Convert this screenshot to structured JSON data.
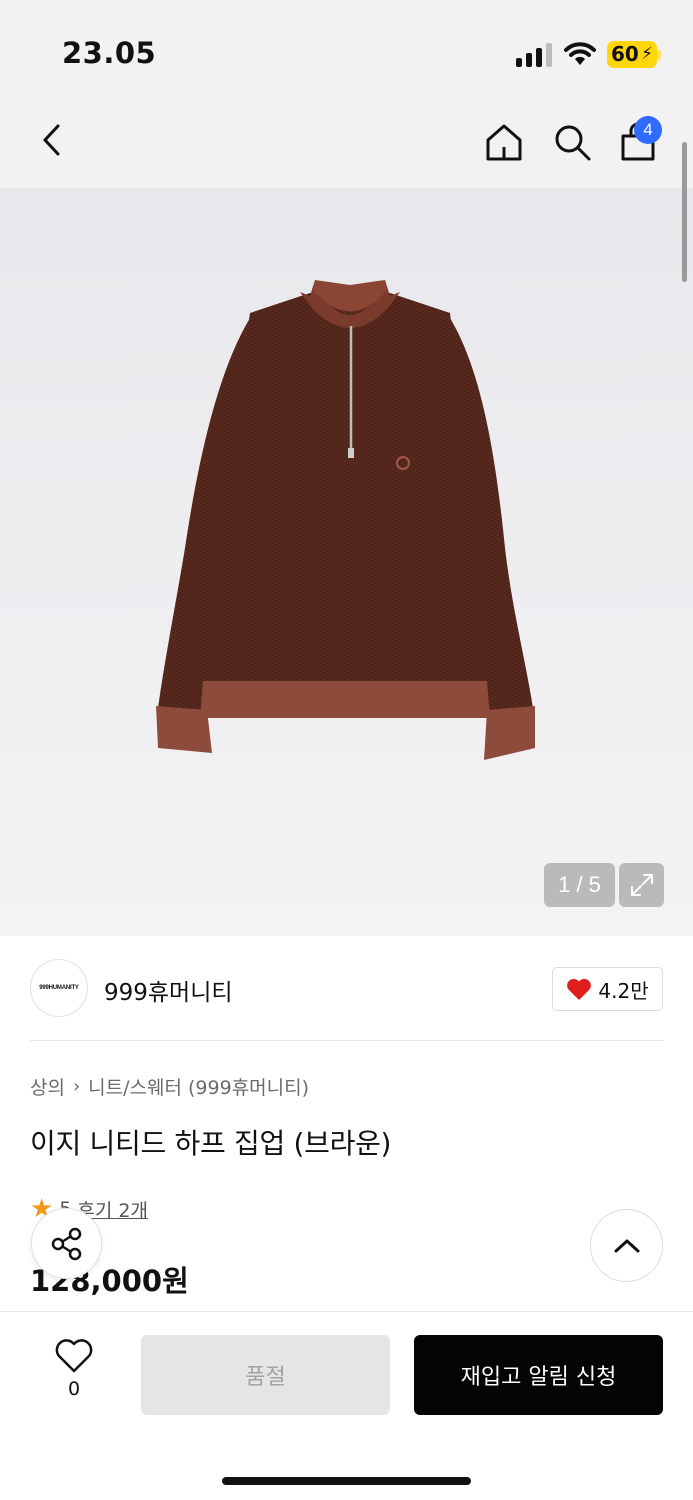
{
  "status_bar": {
    "time": "23.05",
    "battery_level": "60",
    "battery_color": "#ffd60a",
    "battery_charging_icon": "bolt-icon"
  },
  "header": {
    "back_icon": "chevron-left-icon",
    "home_icon": "home-icon",
    "search_icon": "search-icon",
    "cart_icon": "shopping-bag-icon",
    "cart_count": "4",
    "badge_color": "#2f6bff"
  },
  "gallery": {
    "counter": "1 / 5",
    "current_image": 1,
    "total_images": 5,
    "expand_icon": "expand-icon"
  },
  "brand": {
    "logo_text": "999HUMANITY",
    "name": "999휴머니티",
    "like_icon": "heart-filled-icon",
    "like_count": "4.2만",
    "like_color": "#e01e1e"
  },
  "product": {
    "breadcrumb": [
      "상의",
      "니트/스웨터 (999휴머니티)"
    ],
    "title": "이지 니티드 하프 집업 (브라운)",
    "rating": "5",
    "review_text": "후기 2개",
    "price": "128,000원"
  },
  "floating": {
    "share_icon": "share-icon",
    "scroll_top_icon": "chevron-up-icon"
  },
  "bottom_bar": {
    "wish_icon": "heart-outline-icon",
    "wish_count": "0",
    "soldout_label": "품절",
    "restock_label": "재입고 알림 신청"
  }
}
